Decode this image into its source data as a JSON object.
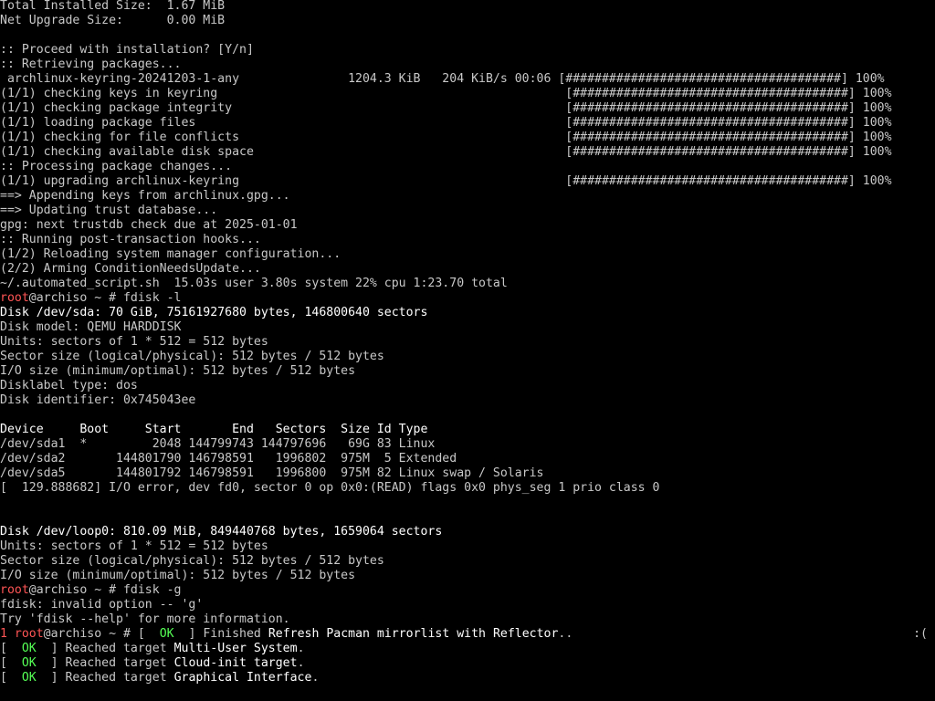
{
  "terminal": {
    "lines": [
      {
        "segments": [
          {
            "text": "Total Installed Size:  1.67 MiB"
          }
        ]
      },
      {
        "segments": [
          {
            "text": "Net Upgrade Size:      0.00 MiB"
          }
        ]
      },
      {
        "segments": [
          {
            "text": ""
          }
        ]
      },
      {
        "segments": [
          {
            "text": ":: Proceed with installation? [Y/n]"
          }
        ]
      },
      {
        "segments": [
          {
            "text": ":: Retrieving packages..."
          }
        ]
      },
      {
        "segments": [
          {
            "text": " archlinux-keyring-20241203-1-any               1204.3 KiB   204 KiB/s 00:06 [######################################] 100%"
          }
        ]
      },
      {
        "segments": [
          {
            "text": "(1/1) checking keys in keyring                                                [######################################] 100%"
          }
        ]
      },
      {
        "segments": [
          {
            "text": "(1/1) checking package integrity                                              [######################################] 100%"
          }
        ]
      },
      {
        "segments": [
          {
            "text": "(1/1) loading package files                                                   [######################################] 100%"
          }
        ]
      },
      {
        "segments": [
          {
            "text": "(1/1) checking for file conflicts                                             [######################################] 100%"
          }
        ]
      },
      {
        "segments": [
          {
            "text": "(1/1) checking available disk space                                           [######################################] 100%"
          }
        ]
      },
      {
        "segments": [
          {
            "text": ":: Processing package changes..."
          }
        ]
      },
      {
        "segments": [
          {
            "text": "(1/1) upgrading archlinux-keyring                                             [######################################] 100%"
          }
        ]
      },
      {
        "segments": [
          {
            "text": "==> Appending keys from archlinux.gpg..."
          }
        ]
      },
      {
        "segments": [
          {
            "text": "==> Updating trust database..."
          }
        ]
      },
      {
        "segments": [
          {
            "text": "gpg: next trustdb check due at 2025-01-01"
          }
        ]
      },
      {
        "segments": [
          {
            "text": ":: Running post-transaction hooks..."
          }
        ]
      },
      {
        "segments": [
          {
            "text": "(1/2) Reloading system manager configuration..."
          }
        ]
      },
      {
        "segments": [
          {
            "text": "(2/2) Arming ConditionNeedsUpdate..."
          }
        ]
      },
      {
        "segments": [
          {
            "text": "~/.automated_script.sh  15.03s user 3.80s system 22% cpu 1:23.70 total"
          }
        ]
      },
      {
        "segments": [
          {
            "text": "root",
            "style": "red"
          },
          {
            "text": "@archiso ~ # fdisk -l"
          }
        ]
      },
      {
        "segments": [
          {
            "text": "Disk /dev/sda: 70 GiB, 75161927680 bytes, 146800640 sectors",
            "style": "bold"
          }
        ]
      },
      {
        "segments": [
          {
            "text": "Disk model: QEMU HARDDISK"
          }
        ]
      },
      {
        "segments": [
          {
            "text": "Units: sectors of 1 * 512 = 512 bytes"
          }
        ]
      },
      {
        "segments": [
          {
            "text": "Sector size (logical/physical): 512 bytes / 512 bytes"
          }
        ]
      },
      {
        "segments": [
          {
            "text": "I/O size (minimum/optimal): 512 bytes / 512 bytes"
          }
        ]
      },
      {
        "segments": [
          {
            "text": "Disklabel type: dos"
          }
        ]
      },
      {
        "segments": [
          {
            "text": "Disk identifier: 0x745043ee"
          }
        ]
      },
      {
        "segments": [
          {
            "text": ""
          }
        ]
      },
      {
        "segments": [
          {
            "text": "Device     Boot     Start       End   Sectors  Size Id Type",
            "style": "bold"
          }
        ]
      },
      {
        "segments": [
          {
            "text": "/dev/sda1  *         2048 144799743 144797696   69G 83 Linux"
          }
        ]
      },
      {
        "segments": [
          {
            "text": "/dev/sda2       144801790 146798591   1996802  975M  5 Extended"
          }
        ]
      },
      {
        "segments": [
          {
            "text": "/dev/sda5       144801792 146798591   1996800  975M 82 Linux swap / Solaris"
          }
        ]
      },
      {
        "segments": [
          {
            "text": "[  129.888682] I/O error, dev fd0, sector 0 op 0x0:(READ) flags 0x0 phys_seg 1 prio class 0"
          }
        ]
      },
      {
        "segments": [
          {
            "text": ""
          }
        ]
      },
      {
        "segments": [
          {
            "text": ""
          }
        ]
      },
      {
        "segments": [
          {
            "text": "Disk /dev/loop0: 810.09 MiB, 849440768 bytes, 1659064 sectors",
            "style": "bold"
          }
        ]
      },
      {
        "segments": [
          {
            "text": "Units: sectors of 1 * 512 = 512 bytes"
          }
        ]
      },
      {
        "segments": [
          {
            "text": "Sector size (logical/physical): 512 bytes / 512 bytes"
          }
        ]
      },
      {
        "segments": [
          {
            "text": "I/O size (minimum/optimal): 512 bytes / 512 bytes"
          }
        ]
      },
      {
        "segments": [
          {
            "text": "root",
            "style": "red"
          },
          {
            "text": "@archiso ~ # fdisk -g"
          }
        ]
      },
      {
        "segments": [
          {
            "text": "fdisk: invalid option -- 'g'"
          }
        ]
      },
      {
        "segments": [
          {
            "text": "Try 'fdisk --help' for more information."
          }
        ]
      },
      {
        "segments": [
          {
            "text": "1 ",
            "style": "red"
          },
          {
            "text": "root",
            "style": "red"
          },
          {
            "text": "@archiso ~ # [  "
          },
          {
            "text": "OK",
            "style": "green"
          },
          {
            "text": "  ] Finished "
          },
          {
            "text": "Refresh Pacman mirrorlist with Reflector",
            "style": "bold"
          },
          {
            "text": ".."
          }
        ],
        "right": ":("
      },
      {
        "segments": [
          {
            "text": "[  "
          },
          {
            "text": "OK",
            "style": "green"
          },
          {
            "text": "  ] Reached target "
          },
          {
            "text": "Multi-User System",
            "style": "bold"
          },
          {
            "text": "."
          }
        ]
      },
      {
        "segments": [
          {
            "text": "[  "
          },
          {
            "text": "OK",
            "style": "green"
          },
          {
            "text": "  ] Reached target "
          },
          {
            "text": "Cloud-init target",
            "style": "bold"
          },
          {
            "text": "."
          }
        ]
      },
      {
        "segments": [
          {
            "text": "[  "
          },
          {
            "text": "OK",
            "style": "green"
          },
          {
            "text": "  ] Reached target "
          },
          {
            "text": "Graphical Interface",
            "style": "bold"
          },
          {
            "text": "."
          }
        ]
      }
    ]
  },
  "colors": {
    "background": "#000000",
    "foreground": "#c8c8c8",
    "bold": "#ffffff",
    "prompt_user": "#ff5555",
    "status_ok": "#55ff55"
  }
}
